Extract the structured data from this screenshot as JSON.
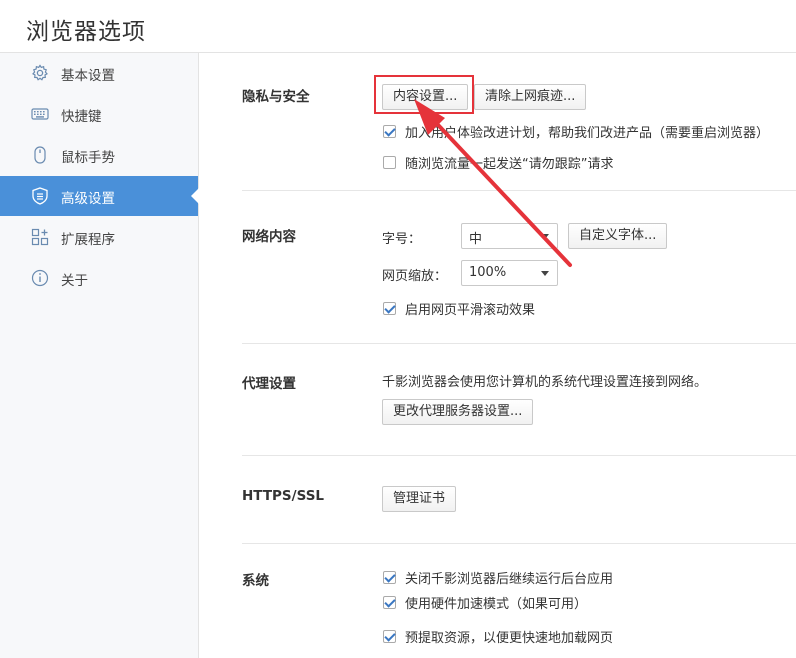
{
  "window": {
    "title": "浏览器选项"
  },
  "sidebar": {
    "items": [
      {
        "label": "基本设置",
        "icon": "gear-icon",
        "active": false
      },
      {
        "label": "快捷键",
        "icon": "keyboard-icon",
        "active": false
      },
      {
        "label": "鼠标手势",
        "icon": "mouse-icon",
        "active": false
      },
      {
        "label": "高级设置",
        "icon": "shield-icon",
        "active": true
      },
      {
        "label": "扩展程序",
        "icon": "extensions-icon",
        "active": false
      },
      {
        "label": "关于",
        "icon": "info-icon",
        "active": false
      }
    ]
  },
  "privacy": {
    "title": "隐私与安全",
    "content_settings_button": "内容设置...",
    "clear_history_button": "清除上网痕迹...",
    "join_program": {
      "label": "加入用户体验改进计划，帮助我们改进产品（需要重启浏览器）",
      "checked": true
    },
    "do_not_track": {
      "label": "随浏览流量一起发送“请勿跟踪”请求",
      "checked": false
    }
  },
  "web_content": {
    "title": "网络内容",
    "font_size_label": "字号：",
    "font_size_value": "中",
    "custom_fonts_button": "自定义字体...",
    "zoom_label": "网页缩放：",
    "zoom_value": "100%",
    "smooth_scroll": {
      "label": "启用网页平滑滚动效果",
      "checked": true
    }
  },
  "proxy": {
    "title": "代理设置",
    "description": "千影浏览器会使用您计算机的系统代理设置连接到网络。",
    "change_button": "更改代理服务器设置..."
  },
  "https": {
    "title": "HTTPS/SSL",
    "manage_certs_button": "管理证书"
  },
  "system": {
    "title": "系统",
    "background_apps": {
      "label": "关闭千影浏览器后继续运行后台应用",
      "checked": true
    },
    "hardware_accel": {
      "label": "使用硬件加速模式（如果可用）",
      "checked": true
    },
    "prefetch": {
      "label": "预提取资源，以便更快速地加载网页",
      "checked": true
    }
  },
  "colors": {
    "accent": "#4a90d9",
    "annotation": "#e5333a",
    "check": "#3a77c2"
  }
}
